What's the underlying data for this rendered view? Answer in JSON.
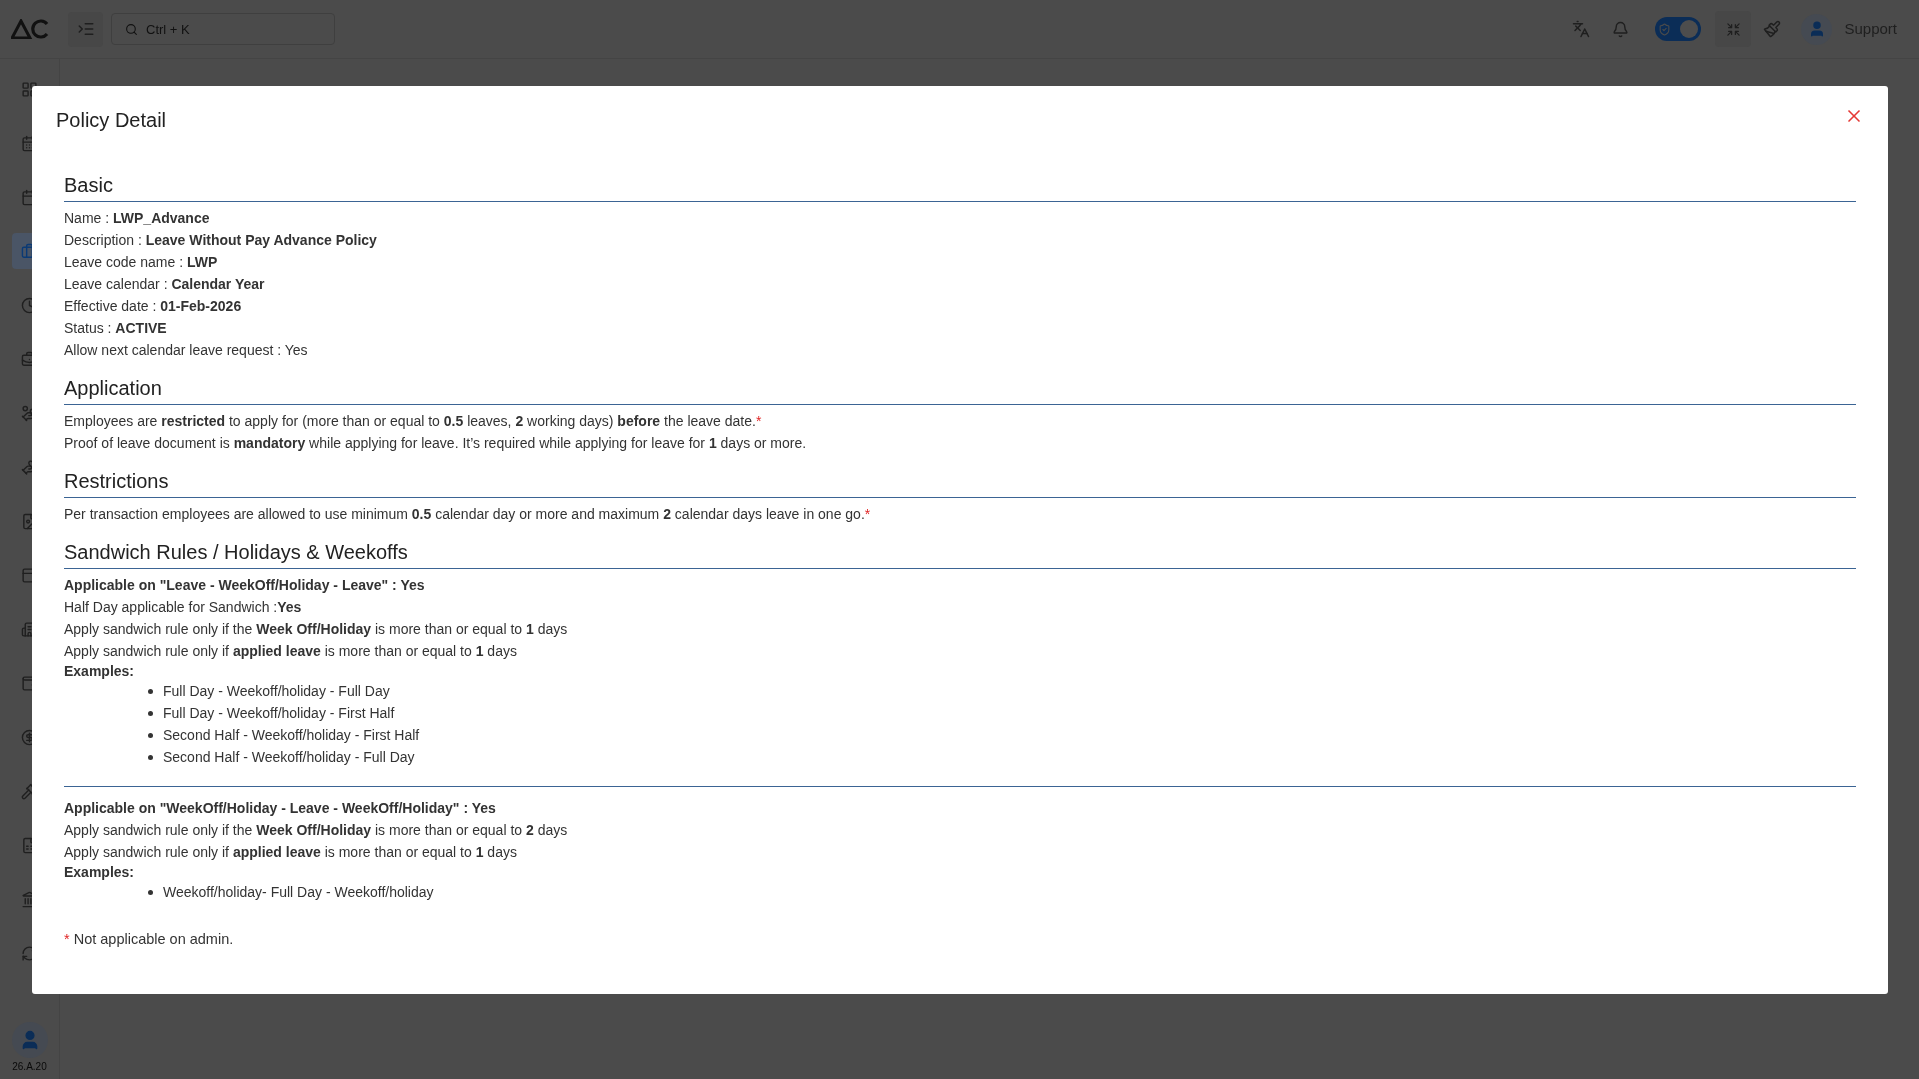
{
  "topbar": {
    "search": {
      "placeholder": "Ctrl + K"
    },
    "theme_toggle": {
      "on": true
    },
    "user": "Support"
  },
  "sidebar": {
    "items": [
      {
        "selected": false
      },
      {
        "selected": false
      },
      {
        "selected": false
      },
      {
        "selected": true
      },
      {
        "selected": false
      },
      {
        "selected": false
      },
      {
        "selected": false
      },
      {
        "selected": false
      },
      {
        "selected": false
      },
      {
        "selected": false
      },
      {
        "selected": false
      },
      {
        "selected": false
      },
      {
        "selected": false
      },
      {
        "selected": false
      },
      {
        "selected": false
      },
      {
        "selected": false
      },
      {
        "selected": false
      }
    ],
    "version": "26.A.20"
  },
  "dialog": {
    "title": "Policy Detail",
    "sections": [
      {
        "title": "Basic",
        "groups": [
          [
            {
              "kind": "line",
              "text": "Name : **LWP_Advance**"
            },
            {
              "kind": "line",
              "text": "Description : **Leave Without Pay Advance Policy**"
            },
            {
              "kind": "line",
              "text": "Leave code name : **LWP**"
            },
            {
              "kind": "line",
              "text": "Leave calendar : **Calendar Year**"
            },
            {
              "kind": "line",
              "text": "Effective date : **01-Feb-2026**"
            },
            {
              "kind": "line",
              "text": "Status : **ACTIVE**"
            },
            {
              "kind": "line",
              "text": "Allow next calendar leave request : Yes"
            }
          ]
        ]
      },
      {
        "title": "Application",
        "groups": [
          [
            {
              "kind": "line",
              "text": "Employees are **restricted** to apply for (more than or equal to **0.5** leaves, **2** working days) **before** the leave date.",
              "mark": "*"
            },
            {
              "kind": "line",
              "text": "Proof of leave document is **mandatory** while applying for leave. It’s required while applying for leave for **1** days or more."
            }
          ]
        ]
      },
      {
        "title": "Restrictions",
        "groups": [
          [
            {
              "kind": "line",
              "text": "Per transaction employees are allowed to use minimum **0.5** calendar day or more and maximum **2** calendar days leave in one go.",
              "mark": "*"
            }
          ]
        ]
      },
      {
        "title": "Sandwich Rules / Holidays & Weekoffs",
        "groups": [
          [
            {
              "kind": "strong",
              "text": "Applicable on \"Leave - WeekOff/Holiday - Leave\" : Yes"
            },
            {
              "kind": "line",
              "text": "Half Day applicable for Sandwich :**Yes**"
            },
            {
              "kind": "line",
              "text": "Apply sandwich rule only if the **Week Off/Holiday** is more than or equal to **1** days"
            },
            {
              "kind": "line",
              "text": "Apply sandwich rule only if **applied leave** is more than or equal to **1** days"
            },
            {
              "kind": "examples",
              "label": "Examples:",
              "items": [
                "Full Day - Weekoff/holiday - Full Day",
                "Full Day - Weekoff/holiday - First Half",
                "Second Half - Weekoff/holiday - First Half",
                "Second Half - Weekoff/holiday - Full Day"
              ]
            }
          ],
          [
            {
              "kind": "strong",
              "text": "Applicable on \"WeekOff/Holiday - Leave - WeekOff/Holiday\" : Yes"
            },
            {
              "kind": "line",
              "text": "Apply sandwich rule only if the **Week Off/Holiday** is more than or equal to **2** days"
            },
            {
              "kind": "line",
              "text": "Apply sandwich rule only if **applied leave** is more than or equal to **1** days"
            },
            {
              "kind": "examples",
              "label": "Examples:",
              "items": [
                "Weekoff/holiday- Full Day - Weekoff/holiday"
              ]
            }
          ]
        ]
      }
    ],
    "footnote": {
      "mark": "*",
      "text": "Not applicable on admin."
    }
  }
}
